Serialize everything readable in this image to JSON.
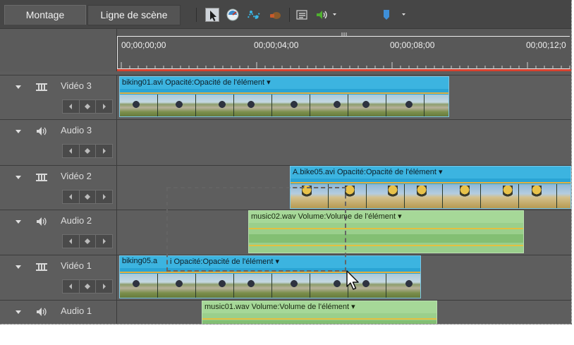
{
  "tabs": [
    {
      "label": "Montage",
      "active": true
    },
    {
      "label": "Ligne de scène",
      "active": false
    }
  ],
  "toolbar": {
    "icons": [
      "pointer-tool-icon",
      "time-stretch-icon",
      "smart-mix-icon",
      "audio-sweep-icon",
      "properties-icon",
      "volume-menu-icon",
      "marker-menu-icon"
    ]
  },
  "ruler": {
    "timecodes": [
      "00;00;00;00",
      "00;00;04;00",
      "00;00;08;00",
      "00;00;12;0"
    ]
  },
  "tracks": [
    {
      "name": "Vidéo 3",
      "kind": "video"
    },
    {
      "name": "Audio 3",
      "kind": "audio"
    },
    {
      "name": "Vidéo 2",
      "kind": "video"
    },
    {
      "name": "Audio 2",
      "kind": "audio"
    },
    {
      "name": "Vidéo 1",
      "kind": "video"
    },
    {
      "name": "Audio 1",
      "kind": "audio"
    }
  ],
  "clips": {
    "v3": {
      "label": "biking01.avi  Opacité:Opacité de l'élément ▾"
    },
    "v2": {
      "label": "A.bike05.avi  Opacité:Opacité de l'élément ▾"
    },
    "a2": {
      "label": "music02.wav Volume:Volume de l'élément ▾"
    },
    "v1a": {
      "label": "biking05.a"
    },
    "v1b": {
      "label": "i   Opacité:Opacité de l'élément ▾"
    },
    "a1": {
      "label": "music01.wav Volume:Volume de l'élément ▾"
    }
  },
  "colors": {
    "video_clip": "#2aa4d4",
    "audio_clip": "#9acf8c",
    "playhead": "#d9412e",
    "keyline": "#e3b040"
  }
}
